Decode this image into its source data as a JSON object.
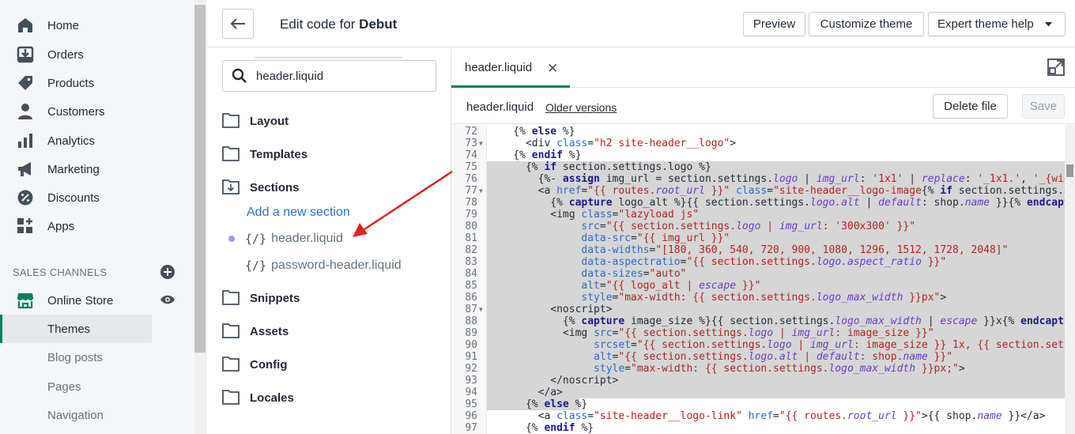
{
  "nav": {
    "items": [
      {
        "label": "Home",
        "icon": "home-icon"
      },
      {
        "label": "Orders",
        "icon": "orders-icon"
      },
      {
        "label": "Products",
        "icon": "tag-icon"
      },
      {
        "label": "Customers",
        "icon": "person-icon"
      },
      {
        "label": "Analytics",
        "icon": "bar-chart-icon"
      },
      {
        "label": "Marketing",
        "icon": "megaphone-icon"
      },
      {
        "label": "Discounts",
        "icon": "discount-icon"
      },
      {
        "label": "Apps",
        "icon": "apps-icon"
      }
    ],
    "sales_channels_header": "SALES CHANNELS",
    "online_store": "Online Store",
    "sub_items": [
      "Themes",
      "Blog posts",
      "Pages",
      "Navigation"
    ]
  },
  "topbar": {
    "title_prefix": "Edit code for ",
    "theme_name": "Debut",
    "preview": "Preview",
    "customize": "Customize theme",
    "expert_help": "Expert theme help"
  },
  "tree": {
    "search_value": "header.liquid",
    "folders": [
      "Layout",
      "Templates",
      "Sections",
      "Snippets",
      "Assets",
      "Config",
      "Locales"
    ],
    "add_section": "Add a new section",
    "files": [
      {
        "tag": "{/}",
        "name": "header.liquid"
      },
      {
        "tag": "{/}",
        "name": "password-header.liquid"
      }
    ]
  },
  "editor": {
    "tab_label": "header.liquid",
    "file_name": "header.liquid",
    "older_versions": "Older versions",
    "delete_file": "Delete file",
    "save": "Save",
    "first_line": 72
  },
  "colors": {
    "accent": "#008060",
    "link": "#2c6ecb",
    "selection": "#d6d6d6",
    "annotation_arrow": "#e02020"
  }
}
